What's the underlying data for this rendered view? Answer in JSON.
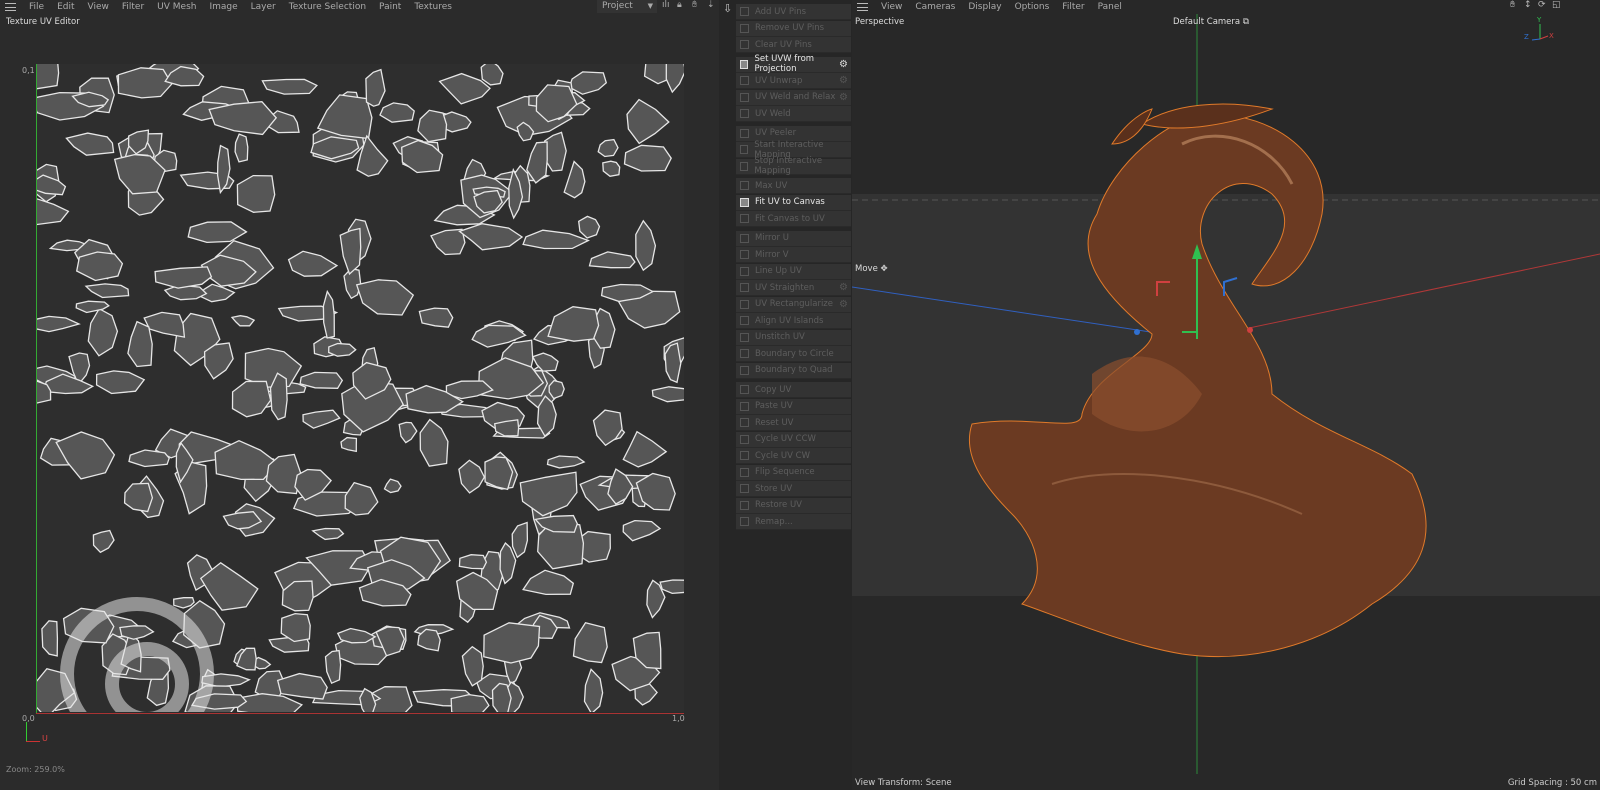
{
  "uv_editor": {
    "menu": [
      "File",
      "Edit",
      "View",
      "Filter",
      "UV Mesh",
      "Image",
      "Layer",
      "Texture Selection",
      "Paint",
      "Textures"
    ],
    "project_dropdown": "Project",
    "title": "Texture UV Editor",
    "label_top_left": "0,1",
    "label_origin": "0,0",
    "label_right": "1,0",
    "axis_u": "U",
    "zoom": "Zoom: 259.0%"
  },
  "uv_tools": [
    {
      "label": "Add UV Pins",
      "enabled": false
    },
    {
      "label": "Remove UV Pins",
      "enabled": false
    },
    {
      "label": "Clear UV Pins",
      "enabled": false
    },
    {
      "label": "Set UVW from Projection",
      "enabled": true,
      "gear": true
    },
    {
      "label": "UV Unwrap",
      "enabled": false,
      "gear": true
    },
    {
      "label": "UV Weld and Relax",
      "enabled": false,
      "gear": true
    },
    {
      "label": "UV Weld",
      "enabled": false
    },
    {
      "label": "UV Peeler",
      "enabled": false
    },
    {
      "label": "Start Interactive Mapping",
      "enabled": false
    },
    {
      "label": "Stop Interactive Mapping",
      "enabled": false
    },
    {
      "label": "Max UV",
      "enabled": false
    },
    {
      "label": "Fit UV to Canvas",
      "enabled": true
    },
    {
      "label": "Fit Canvas to UV",
      "enabled": false
    },
    {
      "label": "Mirror U",
      "enabled": false
    },
    {
      "label": "Mirror V",
      "enabled": false
    },
    {
      "label": "Line Up UV",
      "enabled": false
    },
    {
      "label": "UV Straighten",
      "enabled": false,
      "gear": true
    },
    {
      "label": "UV Rectangularize",
      "enabled": false,
      "gear": true
    },
    {
      "label": "Align UV Islands",
      "enabled": false
    },
    {
      "label": "Unstitch UV",
      "enabled": false
    },
    {
      "label": "Boundary to Circle",
      "enabled": false
    },
    {
      "label": "Boundary to Quad",
      "enabled": false
    },
    {
      "label": "Copy UV",
      "enabled": false
    },
    {
      "label": "Paste UV",
      "enabled": false
    },
    {
      "label": "Reset UV",
      "enabled": false
    },
    {
      "label": "Cycle UV CCW",
      "enabled": false
    },
    {
      "label": "Cycle UV CW",
      "enabled": false
    },
    {
      "label": "Flip Sequence",
      "enabled": false
    },
    {
      "label": "Store UV",
      "enabled": false
    },
    {
      "label": "Restore UV",
      "enabled": false
    },
    {
      "label": "Remap...",
      "enabled": false
    }
  ],
  "viewport": {
    "menu": [
      "View",
      "Cameras",
      "Display",
      "Options",
      "Filter",
      "Panel"
    ],
    "view_name": "Perspective",
    "camera": "Default Camera",
    "tool": "Move",
    "view_transform": "View Transform: Scene",
    "grid_spacing": "Grid Spacing : 50 cm",
    "axis_labels": {
      "y": "Y",
      "x": "X",
      "z": "Z"
    },
    "colors": {
      "object": "#6b3a22",
      "selection_outline": "#e07a2a",
      "x_axis": "#d04040",
      "y_axis": "#30c050",
      "z_axis": "#3070d0"
    }
  }
}
